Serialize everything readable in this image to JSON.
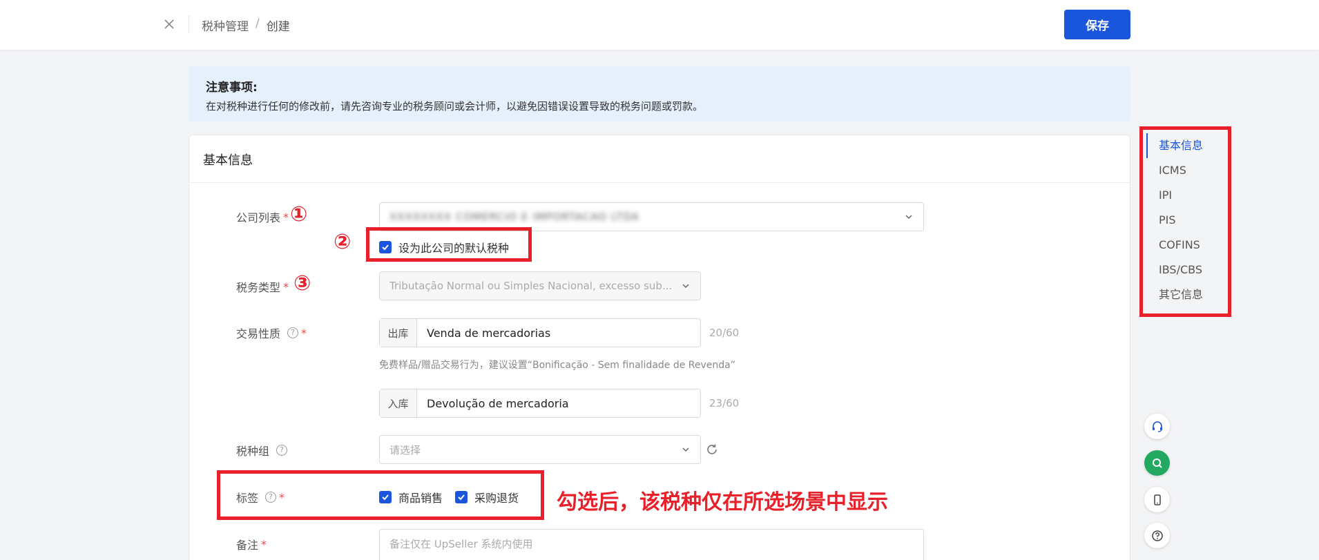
{
  "header": {
    "breadcrumb": [
      "税种管理",
      "/",
      "创建"
    ],
    "save_label": "保存"
  },
  "notice": {
    "title": "注意事项:",
    "text": "在对税种进行任何的修改前，请先咨询专业的税务顾问或会计师，以避免因错误设置导致的税务问题或罚款。"
  },
  "card": {
    "title": "基本信息",
    "fields": {
      "company": {
        "label": "公司列表",
        "required": "*",
        "value": "XXXXXXXX COMERCIO E IMPORTACAO LTDA"
      },
      "default_checkbox": {
        "label": "设为此公司的默认税种",
        "checked": true
      },
      "tax_type": {
        "label": "税务类型",
        "required": "*",
        "value": "Tributação Normal ou Simples Nacional, excesso sub..."
      },
      "transaction": {
        "label": "交易性质",
        "required": "*",
        "outbound": {
          "addon": "出库",
          "value": "Venda de mercadorias",
          "counter": "20/60"
        },
        "hint": "免费样品/赠品交易行为，建议设置“Bonificação - Sem finalidade de Revenda”",
        "inbound": {
          "addon": "入库",
          "value": "Devolução de mercadoria",
          "counter": "23/60"
        }
      },
      "tax_group": {
        "label": "税种组",
        "placeholder": "请选择"
      },
      "tags": {
        "label": "标签",
        "required": "*",
        "options": [
          {
            "label": "商品销售",
            "checked": true
          },
          {
            "label": "采购退货",
            "checked": true
          }
        ]
      },
      "remark": {
        "label": "备注",
        "required": "*",
        "placeholder": "备注仅在 UpSeller 系统内使用"
      }
    }
  },
  "annotations": {
    "num1": "①",
    "num2": "②",
    "num3": "③",
    "note": "勾选后，该税种仅在所选场景中显示"
  },
  "anchor_nav": {
    "items": [
      "基本信息",
      "ICMS",
      "IPI",
      "PIS",
      "COFINS",
      "IBS/CBS",
      "其它信息"
    ],
    "active": "基本信息"
  },
  "colors": {
    "primary": "#1a56db",
    "annotation_red": "#e8202a",
    "fab_green": "#22a860",
    "notice_bg": "#e6f0fd"
  },
  "icons": {
    "close": "close-icon",
    "chevron": "chevron-down-icon",
    "help": "question-circle-icon",
    "refresh": "refresh-icon",
    "headset": "headset-icon",
    "search": "search-icon",
    "mobile": "mobile-icon",
    "question": "question-icon"
  }
}
